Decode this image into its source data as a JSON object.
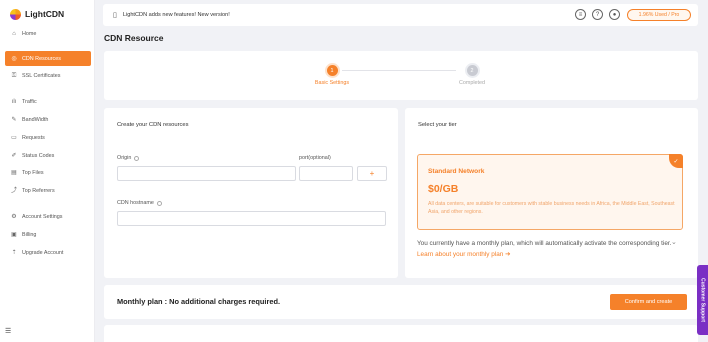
{
  "app": {
    "name": "LightCDN"
  },
  "sidebar": {
    "items": [
      {
        "label": "Home",
        "icon": "home-icon"
      },
      {
        "label": "CDN Resources",
        "icon": "globe-icon",
        "active": true
      },
      {
        "label": "SSL Certificates",
        "icon": "certificate-icon"
      },
      {
        "label": "Traffic",
        "icon": "bar-chart-icon"
      },
      {
        "label": "BandWidth",
        "icon": "bandwidth-icon"
      },
      {
        "label": "Requests",
        "icon": "requests-icon"
      },
      {
        "label": "Status Codes",
        "icon": "status-icon"
      },
      {
        "label": "Top Files",
        "icon": "file-icon"
      },
      {
        "label": "Top Referrers",
        "icon": "referrer-icon"
      },
      {
        "label": "Account Settings",
        "icon": "settings-icon"
      },
      {
        "label": "Billing",
        "icon": "billing-icon"
      },
      {
        "label": "Upgrade Account",
        "icon": "upgrade-icon"
      }
    ]
  },
  "topbar": {
    "announcement": "LightCDN adds new features! New version!",
    "usage": "1.96% Used / Pro"
  },
  "page": {
    "title": "CDN Resource"
  },
  "stepper": {
    "steps": [
      {
        "num": "1",
        "label": "Basic Settings"
      },
      {
        "num": "2",
        "label": "Completed"
      }
    ]
  },
  "form": {
    "heading": "Create your CDN resources",
    "origin_label": "Origin",
    "port_label": "port(optional)",
    "add_label": "+",
    "hostname_label": "CDN hostname"
  },
  "tier": {
    "heading": "Select your tier",
    "name": "Standard Network",
    "price": "$0/GB",
    "description": "All data centers, are suitable for customers with stable business needs in Africa, the Middle East, Southeast Asia, and other regions.",
    "note": "You currently have a monthly plan, which will automatically activate the corresponding tier.",
    "link": "Learn about your monthly plan",
    "check_mark": "✓"
  },
  "bottom": {
    "plan_text": "Monthly plan : No additional charges required.",
    "confirm_label": "Confirm and create"
  },
  "support": {
    "label": "Customer Support"
  },
  "colors": {
    "accent": "#f5812a",
    "support": "#7a2fc4"
  }
}
